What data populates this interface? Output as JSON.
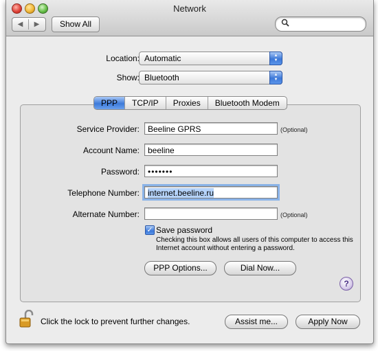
{
  "window": {
    "title": "Network"
  },
  "toolbar": {
    "back_glyph": "◀",
    "forward_glyph": "▶",
    "show_all_label": "Show All",
    "search_placeholder": "",
    "search_icon": "search-icon"
  },
  "location": {
    "label": "Location:",
    "value": "Automatic"
  },
  "show": {
    "label": "Show:",
    "value": "Bluetooth"
  },
  "tabs": [
    {
      "label": "PPP",
      "active": true
    },
    {
      "label": "TCP/IP",
      "active": false
    },
    {
      "label": "Proxies",
      "active": false
    },
    {
      "label": "Bluetooth Modem",
      "active": false
    }
  ],
  "form": {
    "service_provider": {
      "label": "Service Provider:",
      "value": "Beeline GPRS",
      "note": "(Optional)"
    },
    "account_name": {
      "label": "Account Name:",
      "value": "beeline"
    },
    "password": {
      "label": "Password:",
      "value": "•••••••"
    },
    "telephone_number": {
      "label": "Telephone Number:",
      "value": "internet.beeline.ru"
    },
    "alternate_number": {
      "label": "Alternate Number:",
      "value": "",
      "note": "(Optional)"
    }
  },
  "save_password": {
    "checked": true,
    "check_glyph": "✓",
    "label": "Save password",
    "note": "Checking this box allows all users of this computer to access this Internet account without entering a password."
  },
  "buttons": {
    "ppp_options": "PPP Options...",
    "dial_now": "Dial Now...",
    "help_glyph": "?",
    "assist_me": "Assist me...",
    "apply_now": "Apply Now"
  },
  "footer": {
    "lock_icon": "unlocked-padlock-icon",
    "lock_text": "Click the lock to prevent further changes."
  },
  "colors": {
    "accent": "#3c78d8",
    "window_bg": "#ececec",
    "focus_ring": "#8ab3e8"
  }
}
